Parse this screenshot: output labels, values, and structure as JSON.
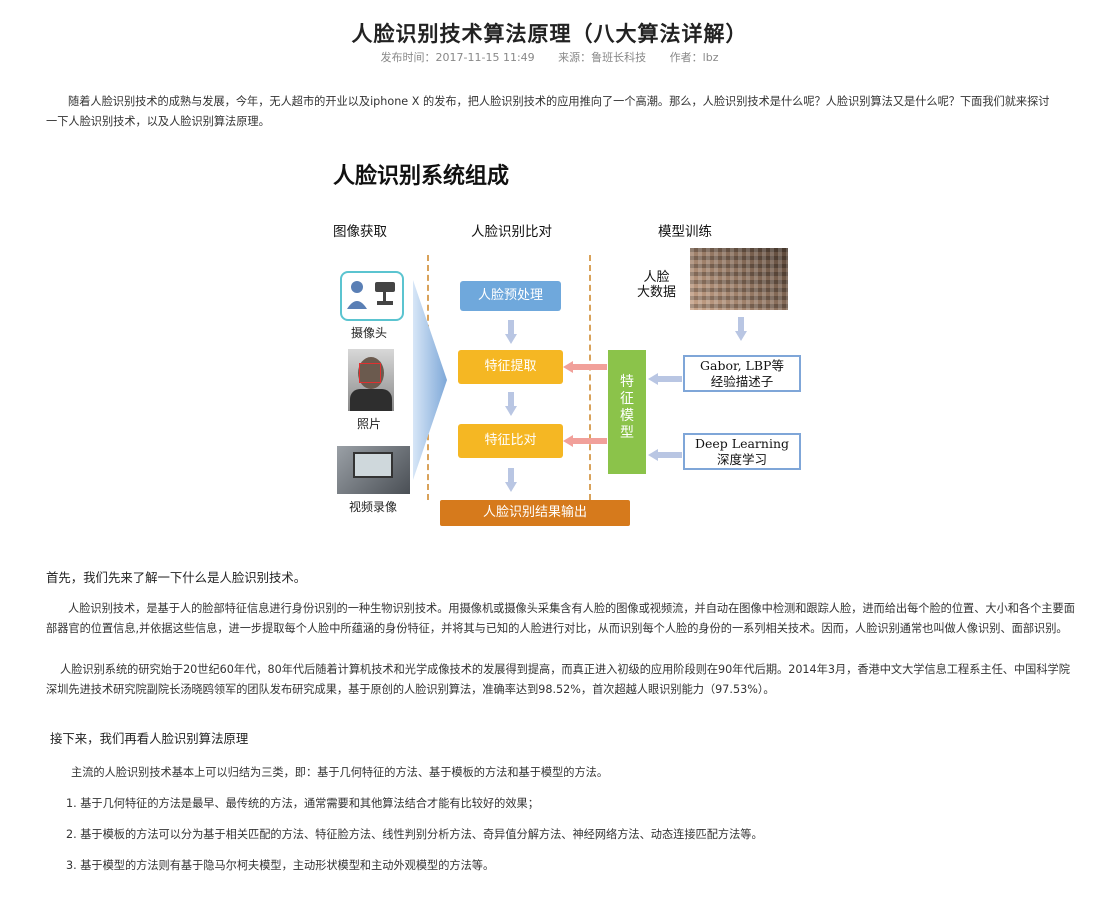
{
  "article": {
    "title": "人脸识别技术算法原理（八大算法详解）",
    "publish_time": "发布时间：2017-11-15 11:49",
    "source": "来源：鲁班长科技",
    "author": "作者：lbz",
    "intro": "随着人脸识别技术的成熟与发展，今年，无人超市的开业以及iphone X 的发布，把人脸识别技术的应用推向了一个高潮。那么，人脸识别技术是什么呢？人脸识别算法又是什么呢？下面我们就来探讨一下人脸识别技术，以及人脸识别算法原理。",
    "section1_heading": "首先，我们先来了解一下什么是人脸识别技术。",
    "definition_p1": "人脸识别技术，是基于人的脸部特征信息进行身份识别的一种生物识别技术。用摄像机或摄像头采集含有人脸的图像或视频流，并自动在图像中检测和跟踪人脸，进而给出每个脸的位置、大小和各个主要面部器官的位置信息,并依据这些信息，进一步提取每个人脸中所蕴涵的身份特征，并将其与已知的人脸进行对比，从而识别每个人脸的身份的一系列相关技术。因而，人脸识别通常也叫做人像识别、面部识别。",
    "definition_p2": "人脸识别系统的研究始于20世纪60年代，80年代后随着计算机技术和光学成像技术的发展得到提高，而真正进入初级的应用阶段则在90年代后期。2014年3月，香港中文大学信息工程系主任、中国科学院深圳先进技术研究院副院长汤晓鸥领军的团队发布研究成果，基于原创的人脸识别算法，准确率达到98.52%，首次超越人眼识别能力（97.53%）。",
    "section2_heading": "接下来，我们再看人脸识别算法原理",
    "methods_intro": "主流的人脸识别技术基本上可以归结为三类，即：基于几何特征的方法、基于模板的方法和基于模型的方法。",
    "methods": [
      "1. 基于几何特征的方法是最早、最传统的方法，通常需要和其他算法结合才能有比较好的效果；",
      "2. 基于模板的方法可以分为基于相关匹配的方法、特征脸方法、线性判别分析方法、奇异值分解方法、神经网络方法、动态连接匹配方法等。",
      "3. 基于模型的方法则有基于隐马尔柯夫模型，主动形状模型和主动外观模型的方法等。"
    ]
  },
  "figure": {
    "title": "人脸识别系统组成",
    "col_acquire": "图像获取",
    "col_compare": "人脸识别比对",
    "col_train": "模型训练",
    "camera_label": "摄像头",
    "photo_label": "照片",
    "video_label": "视频录像",
    "step_preprocess": "人脸预处理",
    "step_extract": "特征提取",
    "step_compare": "特征比对",
    "step_output": "人脸识别结果输出",
    "feature_model": "特\n征\n模\n型",
    "big_data": "人脸\n大数据",
    "desc1_line1": "Gabor, LBP等",
    "desc1_line2": "经验描述子",
    "desc2_line1": "Deep Learning",
    "desc2_line2": "深度学习"
  },
  "colors": {
    "preprocess": "#6fa8dc",
    "step": "#f5b723",
    "output": "#d67a1c",
    "model": "#8bc34a",
    "dashed_divider": "#d9a25a"
  }
}
